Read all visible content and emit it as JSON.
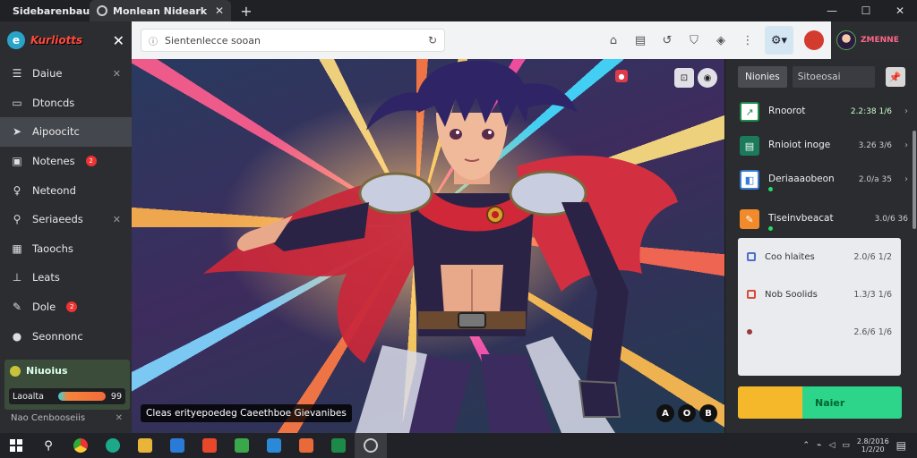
{
  "browser": {
    "tabs": [
      {
        "label": "Sidebarenbaut",
        "active": false
      },
      {
        "label": "Monlean Nideark",
        "active": true
      }
    ],
    "window_controls": [
      "minimize",
      "maximize",
      "close"
    ],
    "address": {
      "placeholder": "Sientenlecce sooan"
    },
    "profile_name": "ZMENNE"
  },
  "brand": {
    "logo_text": "Kurliotts"
  },
  "sidebar": {
    "items": [
      {
        "label": "Daiue",
        "icon": "list-icon",
        "closable": true
      },
      {
        "label": "Dtoncds",
        "icon": "document-icon",
        "closable": false
      },
      {
        "label": "Aipoocitc",
        "icon": "send-icon",
        "closable": false,
        "active": true
      },
      {
        "label": "Notenes",
        "icon": "image-icon",
        "badge": "2"
      },
      {
        "label": "Neteond",
        "icon": "pin-icon"
      },
      {
        "label": "Seriaeeds",
        "icon": "search-icon",
        "closable": true
      },
      {
        "label": "Taoochs",
        "icon": "grid-icon"
      },
      {
        "label": "Leats",
        "icon": "chart-icon"
      },
      {
        "label": "Dole",
        "icon": "tag-icon",
        "badge": "2"
      },
      {
        "label": "Seonnonc",
        "icon": "gear-icon"
      }
    ],
    "promo": {
      "title": "Niuoius",
      "progress_label": "Laoalta",
      "progress_value": "99",
      "progress_fraction": 0.7
    },
    "footer": {
      "label": "Nao Cenbooseiis"
    }
  },
  "viewer": {
    "caption": "Cleas erityepoedeg Caeethboe Gievanibes",
    "controls": [
      "A",
      "O",
      "B"
    ]
  },
  "right_panel": {
    "tabs": [
      "Nionies",
      "Sitoeosai"
    ],
    "items": [
      {
        "label": "Rnoorot",
        "value": "2.2:38 1/6",
        "icon_color": "#1f8a4a",
        "icon": "chart-up-icon"
      },
      {
        "label": "Rnioiot inoge",
        "value": "3.26 3/6",
        "icon_color": "#1a7a5a",
        "icon": "grid-icon"
      },
      {
        "label": "Deriaaaobeon",
        "value": "2.0/a 35",
        "icon_color": "#3a7bd5",
        "icon": "document-icon",
        "dot": true
      },
      {
        "label": "Tiseinvbeacat",
        "value": "3.0/6 36",
        "icon_color": "#f08a2a",
        "icon": "pen-icon",
        "dot": true
      }
    ],
    "card_items": [
      {
        "label": "Coo hlaites",
        "value": "2.0/6 1/2"
      },
      {
        "label": "Nob Soolids",
        "value": "1.3/3 1/6"
      },
      {
        "label": "",
        "value": "2.6/6 1/6"
      }
    ],
    "action_label": "Naier"
  },
  "taskbar": {
    "tray_time": "2.8/2016",
    "tray_date": "1/2/20"
  }
}
